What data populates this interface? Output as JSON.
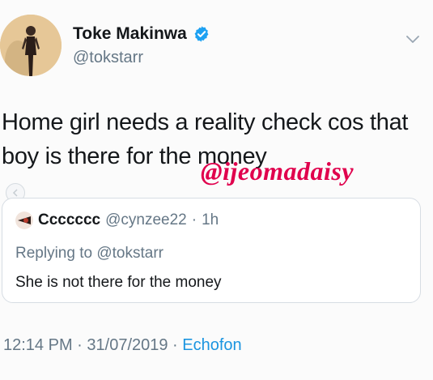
{
  "author": {
    "display_name": "Toke Makinwa",
    "handle": "@tokstarr",
    "verified": true
  },
  "tweet": {
    "text": "Home girl needs a reality check cos that boy is there for the money"
  },
  "watermark": "@ijeomadaisy",
  "quoted_tweet": {
    "name": "Ccccccc",
    "handle": "@cynzee22",
    "separator": "·",
    "time": "1h",
    "replying_to": "Replying to @tokstarr",
    "text": "She is not there for the money"
  },
  "meta": {
    "time": "12:14 PM",
    "separator1": " · ",
    "date": "31/07/2019",
    "separator2": " · ",
    "source": "Echofon"
  },
  "colors": {
    "verified_badge": "#1da1f2",
    "watermark": "#e0004d",
    "link": "#1b95e0",
    "secondary_text": "#657786"
  },
  "icons": {
    "verified": "verified-badge-icon",
    "more": "chevron-down-icon",
    "quote_avatar": "avatar-icon"
  }
}
